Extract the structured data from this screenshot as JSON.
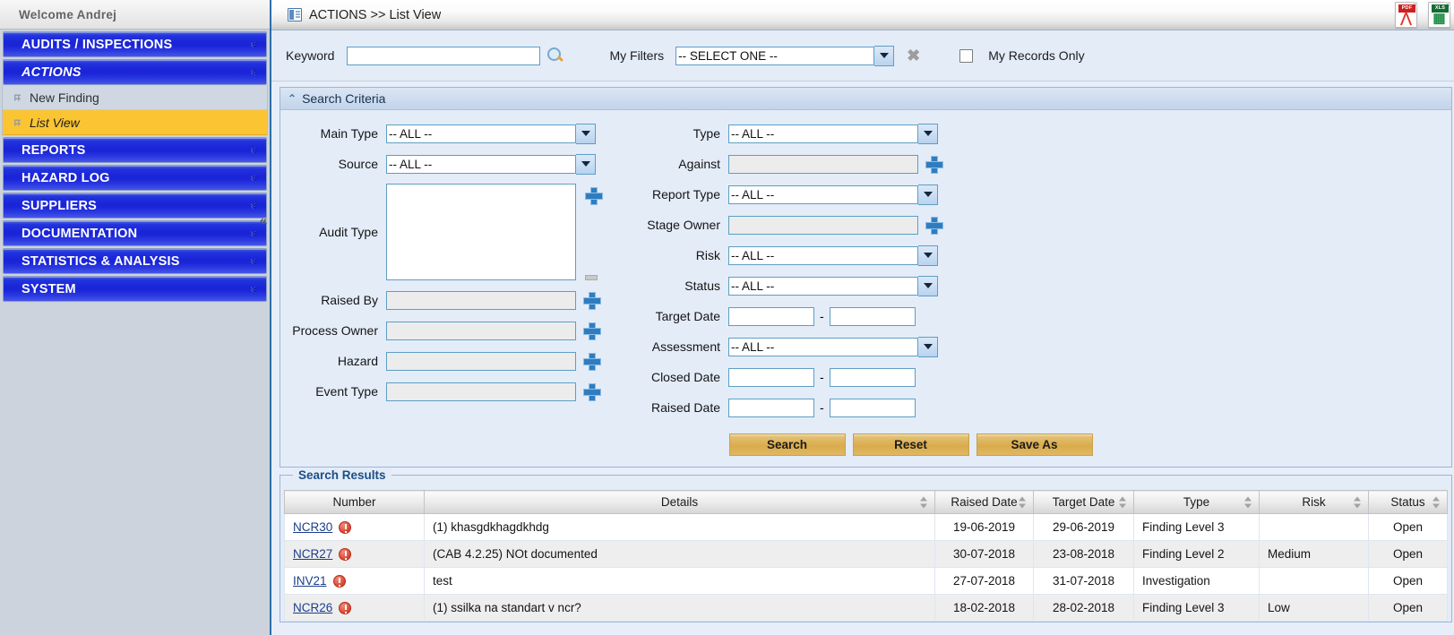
{
  "sidebar": {
    "welcome": "Welcome  Andrej",
    "groups": [
      {
        "label": "AUDITS / INSPECTIONS",
        "icon": "chevron-down-icon",
        "expanded": false,
        "items": []
      },
      {
        "label": "ACTIONS",
        "icon": "chevron-up-icon",
        "expanded": true,
        "items": [
          {
            "label": "New Finding",
            "selected": false
          },
          {
            "label": "List View",
            "selected": true
          }
        ]
      },
      {
        "label": "REPORTS",
        "icon": "chevron-down-icon",
        "expanded": false,
        "items": []
      },
      {
        "label": "HAZARD LOG",
        "icon": "chevron-down-icon",
        "expanded": false,
        "items": []
      },
      {
        "label": "SUPPLIERS",
        "icon": "chevron-down-icon",
        "expanded": false,
        "items": []
      },
      {
        "label": "DOCUMENTATION",
        "icon": "chevron-down-icon",
        "expanded": false,
        "items": []
      },
      {
        "label": "STATISTICS & ANALYSIS",
        "icon": "chevron-down-icon",
        "expanded": false,
        "items": []
      },
      {
        "label": "SYSTEM",
        "icon": "chevron-down-icon",
        "expanded": false,
        "items": []
      }
    ],
    "collapse_glyph": "«"
  },
  "titlebar": {
    "breadcrumb": "ACTIONS  >>  List View",
    "pdf_tag": "PDF",
    "pdf_glyph": "弓",
    "xls_tag": "XLS",
    "xls_glyph": "⬚"
  },
  "filterbar": {
    "keyword_label": "Keyword",
    "keyword_value": "",
    "keyword_placeholder": "",
    "myfilters_label": "My Filters",
    "myfilters_value": "-- SELECT ONE --",
    "clear_glyph": "✖",
    "myrecords_label": "My Records Only",
    "myrecords_checked": false
  },
  "criteria": {
    "panel_title": "Search Criteria",
    "caret": "⌃",
    "left": [
      {
        "label": "Main Type",
        "value": "-- ALL --",
        "kind": "select"
      },
      {
        "label": "Source",
        "value": "-- ALL --",
        "kind": "select"
      },
      {
        "label": "Audit Type",
        "value": "",
        "kind": "listbox"
      },
      {
        "label": "Raised By",
        "value": "",
        "kind": "lookup"
      },
      {
        "label": "Process Owner",
        "value": "",
        "kind": "lookup"
      },
      {
        "label": "Hazard",
        "value": "",
        "kind": "lookup"
      },
      {
        "label": "Event Type",
        "value": "",
        "kind": "lookup"
      }
    ],
    "right": [
      {
        "label": "Type",
        "value": "-- ALL --",
        "kind": "select"
      },
      {
        "label": "Against",
        "value": "",
        "kind": "lookup"
      },
      {
        "label": "Report Type",
        "value": "-- ALL --",
        "kind": "select"
      },
      {
        "label": "Stage Owner",
        "value": "",
        "kind": "lookup"
      },
      {
        "label": "Risk",
        "value": "-- ALL --",
        "kind": "select"
      },
      {
        "label": "Status",
        "value": "-- ALL --",
        "kind": "select"
      },
      {
        "label": "Target Date",
        "from": "",
        "to": "",
        "kind": "daterange"
      },
      {
        "label": "Assessment",
        "value": "-- ALL --",
        "kind": "select"
      },
      {
        "label": "Closed Date",
        "from": "",
        "to": "",
        "kind": "daterange"
      },
      {
        "label": "Raised Date",
        "from": "",
        "to": "",
        "kind": "daterange"
      }
    ],
    "buttons": [
      {
        "label": "Search"
      },
      {
        "label": "Reset"
      },
      {
        "label": "Save As"
      }
    ]
  },
  "results": {
    "legend": "Search Results",
    "columns": [
      {
        "label": "Number",
        "sortable": false
      },
      {
        "label": "Details",
        "sortable": true
      },
      {
        "label": "Raised Date",
        "sortable": true
      },
      {
        "label": "Target Date",
        "sortable": true
      },
      {
        "label": "Type",
        "sortable": true
      },
      {
        "label": "Risk",
        "sortable": true
      },
      {
        "label": "Status",
        "sortable": true
      }
    ],
    "rows": [
      {
        "number": "NCR30",
        "flag": "alert-icon",
        "details": "(1) khasgdkhagdkhdg",
        "raised_date": "19-06-2019",
        "target_date": "29-06-2019",
        "type": "Finding Level 3",
        "risk": "",
        "risk_class": "",
        "status": "Open"
      },
      {
        "number": "NCR27",
        "flag": "alert-icon",
        "details": "(CAB 4.2.25) NOt documented",
        "raised_date": "30-07-2018",
        "target_date": "23-08-2018",
        "type": "Finding Level 2",
        "risk": "Medium",
        "risk_class": "risk-medium",
        "status": "Open"
      },
      {
        "number": "INV21",
        "flag": "alert-icon",
        "details": "test",
        "raised_date": "27-07-2018",
        "target_date": "31-07-2018",
        "type": "Investigation",
        "risk": "",
        "risk_class": "",
        "status": "Open"
      },
      {
        "number": "NCR26",
        "flag": "alert-icon",
        "details": "(1) ssilka na standart v ncr?",
        "raised_date": "18-02-2018",
        "target_date": "28-02-2018",
        "type": "Finding Level 3",
        "risk": "Low",
        "risk_class": "risk-low",
        "status": "Open"
      }
    ]
  },
  "colors": {
    "nav_blue": "#1a25d8",
    "selected_yellow": "#fbc433",
    "button_gold": "#d9ab4b",
    "link_blue": "#1a3e8c",
    "risk_medium": "#e59b29",
    "risk_low": "#2f7a2f"
  }
}
